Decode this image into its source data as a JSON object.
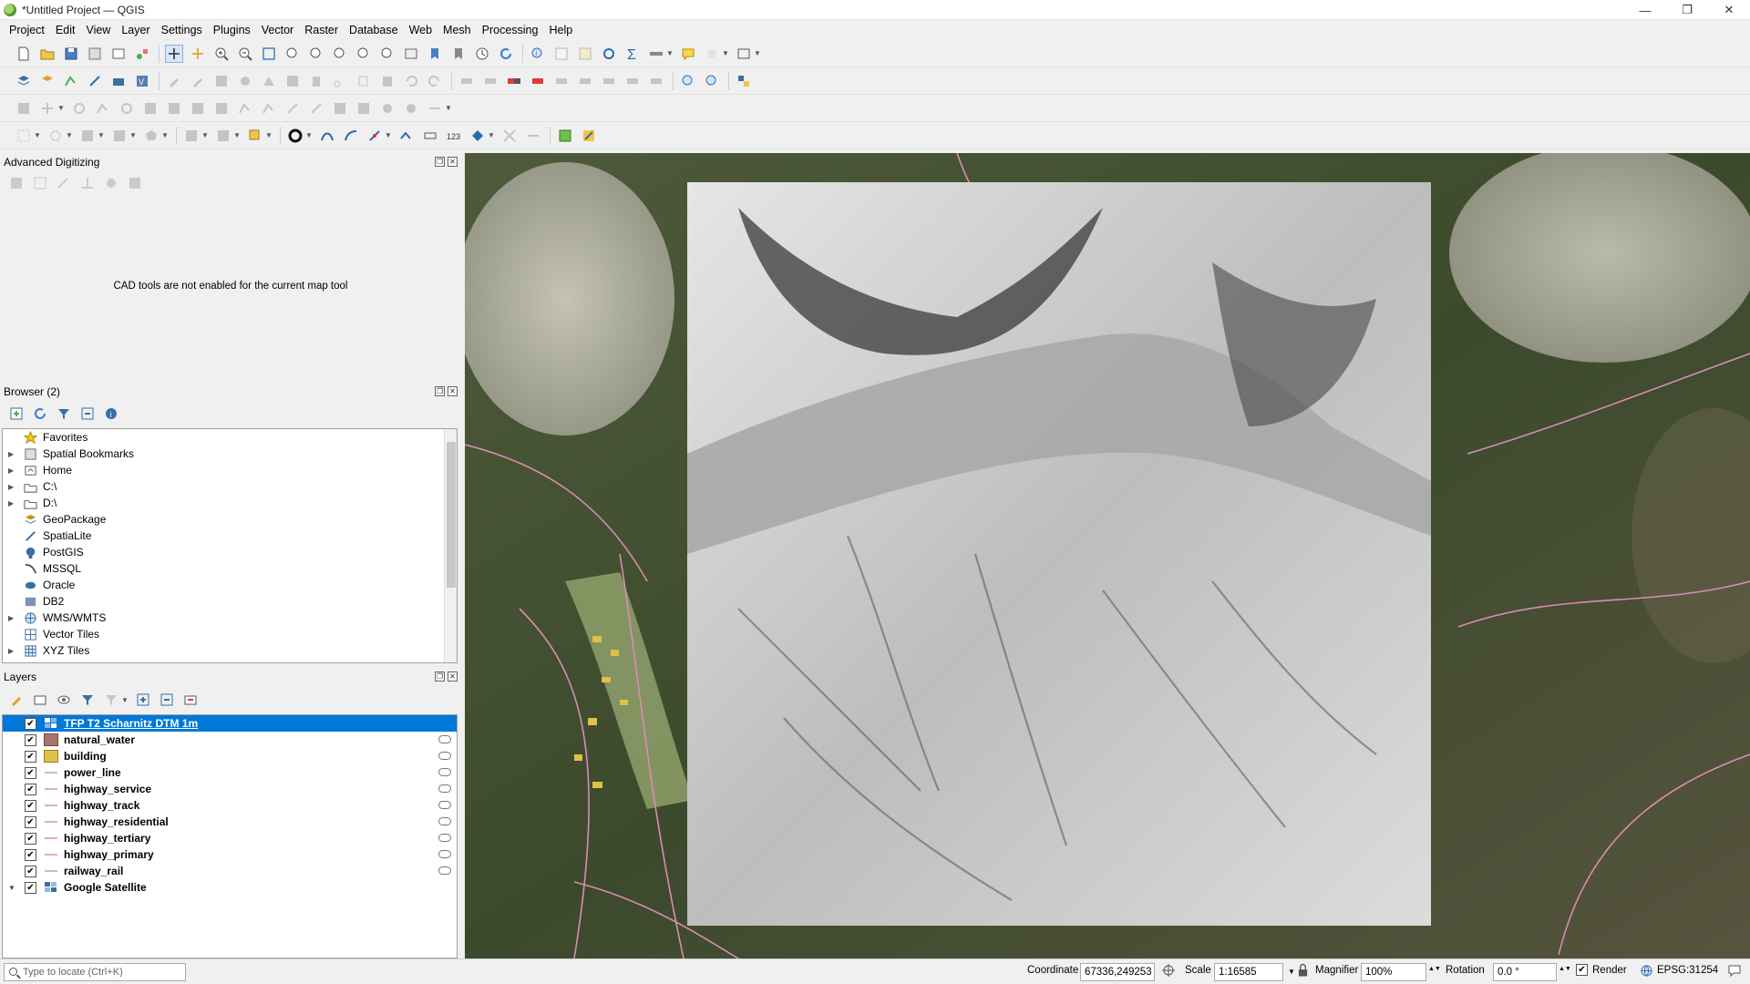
{
  "window": {
    "title": "*Untitled Project — QGIS",
    "controls": [
      "—",
      "❐",
      "✕"
    ]
  },
  "menu": [
    "Project",
    "Edit",
    "View",
    "Layer",
    "Settings",
    "Plugins",
    "Vector",
    "Raster",
    "Database",
    "Web",
    "Mesh",
    "Processing",
    "Help"
  ],
  "panels": {
    "cad": {
      "title": "Advanced Digitizing",
      "message": "CAD tools are not enabled for the current map tool"
    },
    "browser": {
      "title": "Browser (2)",
      "items": [
        {
          "label": "Favorites",
          "icon": "star-icon",
          "expandable": false
        },
        {
          "label": "Spatial Bookmarks",
          "icon": "bookmark-icon",
          "expandable": true
        },
        {
          "label": "Home",
          "icon": "home-folder-icon",
          "expandable": true
        },
        {
          "label": "C:\\",
          "icon": "drive-icon",
          "expandable": true
        },
        {
          "label": "D:\\",
          "icon": "drive-icon",
          "expandable": true
        },
        {
          "label": "GeoPackage",
          "icon": "geopackage-icon",
          "expandable": false
        },
        {
          "label": "SpatiaLite",
          "icon": "spatialite-icon",
          "expandable": false
        },
        {
          "label": "PostGIS",
          "icon": "postgis-icon",
          "expandable": false
        },
        {
          "label": "MSSQL",
          "icon": "mssql-icon",
          "expandable": false
        },
        {
          "label": "Oracle",
          "icon": "oracle-icon",
          "expandable": false
        },
        {
          "label": "DB2",
          "icon": "db2-icon",
          "expandable": false
        },
        {
          "label": "WMS/WMTS",
          "icon": "wms-icon",
          "expandable": true
        },
        {
          "label": "Vector Tiles",
          "icon": "vector-tiles-icon",
          "expandable": false
        },
        {
          "label": "XYZ Tiles",
          "icon": "xyz-tiles-icon",
          "expandable": true
        }
      ]
    },
    "layers": {
      "title": "Layers",
      "items": [
        {
          "label": "TFP T2 Scharnitz DTM 1m",
          "symbol": "raster",
          "color": "#4a6fa5",
          "selected": true
        },
        {
          "label": "natural_water",
          "symbol": "fill",
          "color": "#a9746e"
        },
        {
          "label": "building",
          "symbol": "fill",
          "color": "#e0c04a"
        },
        {
          "label": "power_line",
          "symbol": "line",
          "color": "#c9a0b0"
        },
        {
          "label": "highway_service",
          "symbol": "line",
          "color": "#d98cb3"
        },
        {
          "label": "highway_track",
          "symbol": "line",
          "color": "#d98cb3"
        },
        {
          "label": "highway_residential",
          "symbol": "line",
          "color": "#d98cb3"
        },
        {
          "label": "highway_tertiary",
          "symbol": "line",
          "color": "#d98cb3"
        },
        {
          "label": "highway_primary",
          "symbol": "line",
          "color": "#d98cb3"
        },
        {
          "label": "railway_rail",
          "symbol": "line",
          "color": "#c9a0b0"
        },
        {
          "label": "Google Satellite",
          "symbol": "xyz",
          "color": "#3a6ea5",
          "group": true
        }
      ]
    }
  },
  "status": {
    "locator_placeholder": "Type to locate (Ctrl+K)",
    "coordinate_label": "Coordinate",
    "coordinate_value": "67336,249253",
    "scale_label": "Scale",
    "scale_value": "1:16585",
    "magnifier_label": "Magnifier",
    "magnifier_value": "100%",
    "rotation_label": "Rotation",
    "rotation_value": "0.0 °",
    "render_label": "Render",
    "crs": "EPSG:31254"
  },
  "colors": {
    "selection": "#0078d7",
    "road": "#d98cb3"
  }
}
